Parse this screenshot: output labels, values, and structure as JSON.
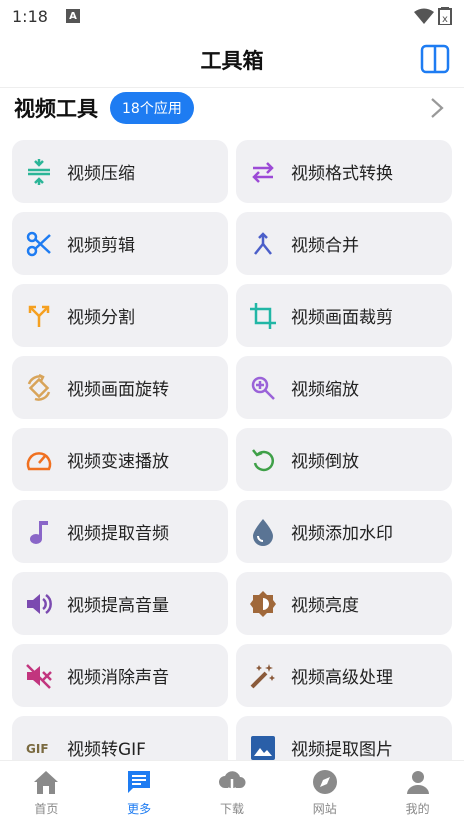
{
  "status_bar": {
    "time": "1:18",
    "notification": "A"
  },
  "app_bar": {
    "title": "工具箱"
  },
  "section": {
    "title": "视频工具",
    "badge": "18个应用"
  },
  "tools": [
    {
      "label": "视频压缩",
      "icon": "compress-icon",
      "color": "#2bb597"
    },
    {
      "label": "视频格式转换",
      "icon": "swap-icon",
      "color": "#9c4ad6"
    },
    {
      "label": "视频剪辑",
      "icon": "scissors-icon",
      "color": "#1e7cf2"
    },
    {
      "label": "视频合并",
      "icon": "merge-icon",
      "color": "#4b5fc9"
    },
    {
      "label": "视频分割",
      "icon": "split-icon",
      "color": "#f5a020"
    },
    {
      "label": "视频画面裁剪",
      "icon": "crop-icon",
      "color": "#21b6a5"
    },
    {
      "label": "视频画面旋转",
      "icon": "rotate-icon",
      "color": "#d8a45a"
    },
    {
      "label": "视频缩放",
      "icon": "zoom-icon",
      "color": "#9a62d8"
    },
    {
      "label": "视频变速播放",
      "icon": "speed-icon",
      "color": "#f07020"
    },
    {
      "label": "视频倒放",
      "icon": "reverse-icon",
      "color": "#3fa048"
    },
    {
      "label": "视频提取音频",
      "icon": "music-note-icon",
      "color": "#8a66c8"
    },
    {
      "label": "视频添加水印",
      "icon": "water-drop-icon",
      "color": "#5a7494"
    },
    {
      "label": "视频提高音量",
      "icon": "volume-up-icon",
      "color": "#7b4ab0"
    },
    {
      "label": "视频亮度",
      "icon": "brightness-icon",
      "color": "#a0683a"
    },
    {
      "label": "视频消除声音",
      "icon": "volume-mute-icon",
      "color": "#c2357e"
    },
    {
      "label": "视频高级处理",
      "icon": "magic-wand-icon",
      "color": "#8a5a3a"
    },
    {
      "label": "视频转GIF",
      "icon": "gif-icon",
      "color": "#7a6a40"
    },
    {
      "label": "视频提取图片",
      "icon": "image-icon",
      "color": "#2a5fa8"
    }
  ],
  "nav": [
    {
      "label": "首页",
      "icon": "home-icon",
      "active": false
    },
    {
      "label": "更多",
      "icon": "more-icon",
      "active": true
    },
    {
      "label": "下载",
      "icon": "download-icon",
      "active": false
    },
    {
      "label": "网站",
      "icon": "compass-icon",
      "active": false
    },
    {
      "label": "我的",
      "icon": "person-icon",
      "active": false
    }
  ],
  "colors": {
    "accent": "#1e7cf2",
    "tile": "#f0f0f3",
    "nav_inactive": "#8a8a8a"
  }
}
